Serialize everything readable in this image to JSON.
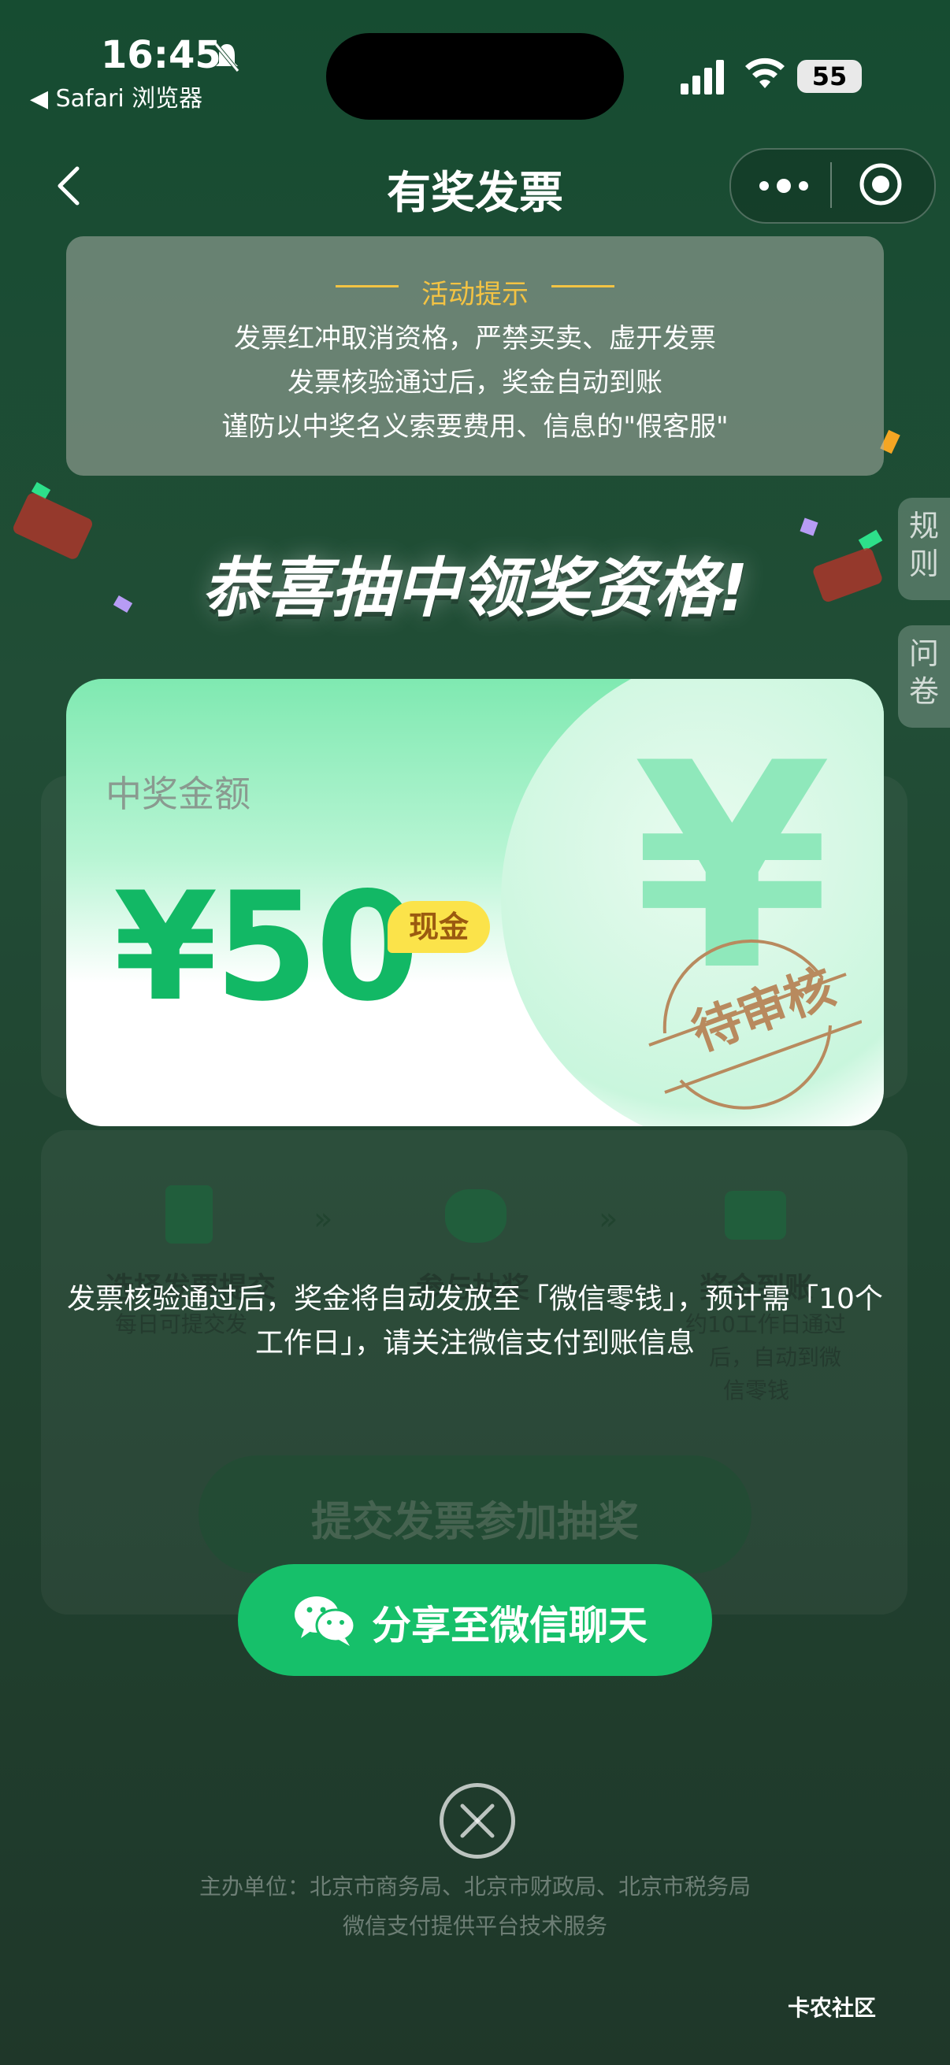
{
  "status_bar": {
    "time": "16:45",
    "back_app": "◀ Safari 浏览器",
    "battery": "55"
  },
  "nav": {
    "title": "有奖发票"
  },
  "notice": {
    "heading": "活动提示",
    "lines": [
      "发票红冲取消资格，严禁买卖、虚开发票",
      "发票核验通过后，奖金自动到账",
      "谨防以中奖名义索要费用、信息的\"假客服\""
    ]
  },
  "congrats": "恭喜抽中领奖资格!",
  "side_tabs": {
    "rules": "规则",
    "survey": "问卷"
  },
  "prize": {
    "label": "中奖金额",
    "amount": "¥50",
    "badge": "现金",
    "watermark_symbol": "¥",
    "stamp": "待审核"
  },
  "background_steps": {
    "step1": "选择发票提交",
    "step2": "参与抽奖",
    "step3": "奖金到账",
    "sub1": "每日可提交发",
    "sub3_a": "约10工作日通过",
    "sub3_b": "后，自动到微",
    "sub3_c": "信零钱",
    "submit_button": "提交发票参加抽奖"
  },
  "tip": "发票核验通过后，奖金将自动发放至「微信零钱」，预计需「10个工作日」，请关注微信支付到账信息",
  "share_button": "分享至微信聊天",
  "footer": {
    "organizers": "主办单位：北京市商务局、北京市财政局、北京市税务局",
    "tech": "微信支付提供平台技术服务"
  },
  "watermark": "卡农社区",
  "colors": {
    "accent_green": "#12b865",
    "button_green": "#16c06a",
    "notice_heading": "#f3c343",
    "stamp": "#b88a5e"
  }
}
